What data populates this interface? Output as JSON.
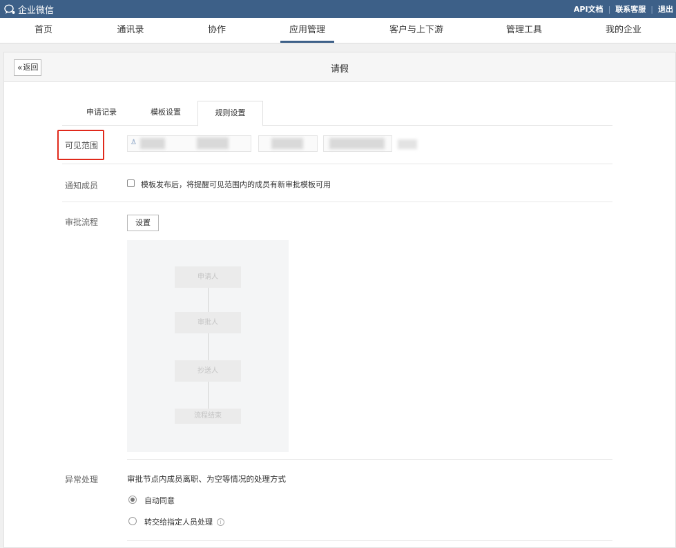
{
  "topbar": {
    "logo_text": "企业微信",
    "links": [
      "API文档",
      "联系客服",
      "退出"
    ],
    "bg_color": "#3d6088"
  },
  "nav": {
    "items": [
      "首页",
      "通讯录",
      "协作",
      "应用管理",
      "客户与上下游",
      "管理工具",
      "我的企业"
    ],
    "active": "应用管理"
  },
  "panel": {
    "back_label": "返回",
    "title": "请假"
  },
  "tabs": {
    "items": [
      "申请记录",
      "模板设置",
      "规则设置"
    ],
    "active": "规则设置"
  },
  "rules": {
    "visible_range_label": "可见范围",
    "notify_label": "通知成员",
    "notify_text": "模板发布后，将提醒可见范围内的成员有新审批模板可用",
    "approval_flow_label": "审批流程",
    "settings_button": "设置",
    "flow_nodes": [
      "申请人",
      "审批人",
      "抄送人",
      "流程结束"
    ],
    "exception_label": "异常处理",
    "exception_desc": "审批节点内成员离职、为空等情况的处理方式",
    "options": [
      "自动同意",
      "转交给指定人员处理"
    ],
    "selected_option": "自动同意"
  },
  "colors": {
    "highlight": "#e0291b",
    "accent": "#3d6088"
  }
}
